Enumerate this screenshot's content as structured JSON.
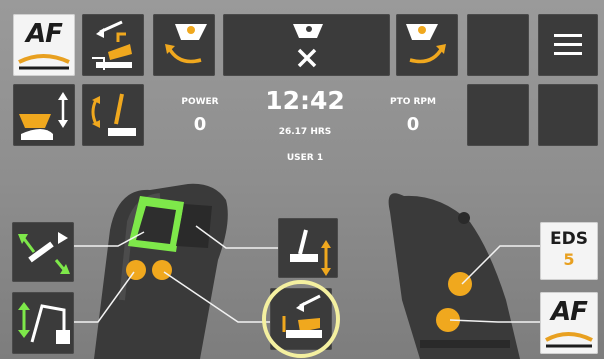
{
  "top_row": {
    "af_tile_label": "AF",
    "hamburger_icon": "menu-icon"
  },
  "status": {
    "power_label": "POWER",
    "power_value": "0",
    "clock": "12:42",
    "hours": "26.17 HRS",
    "user": "USER 1",
    "pto_label": "PTO RPM",
    "pto_value": "0"
  },
  "right_panel": {
    "eds_label": "EDS",
    "eds_value": "5",
    "af_label": "AF"
  },
  "colors": {
    "accent_orange": "#f0a81e",
    "tile_dark": "#3b3b3b",
    "joystick_button_green": "#7ee84a",
    "highlight_ring": "#f4f0a0"
  }
}
